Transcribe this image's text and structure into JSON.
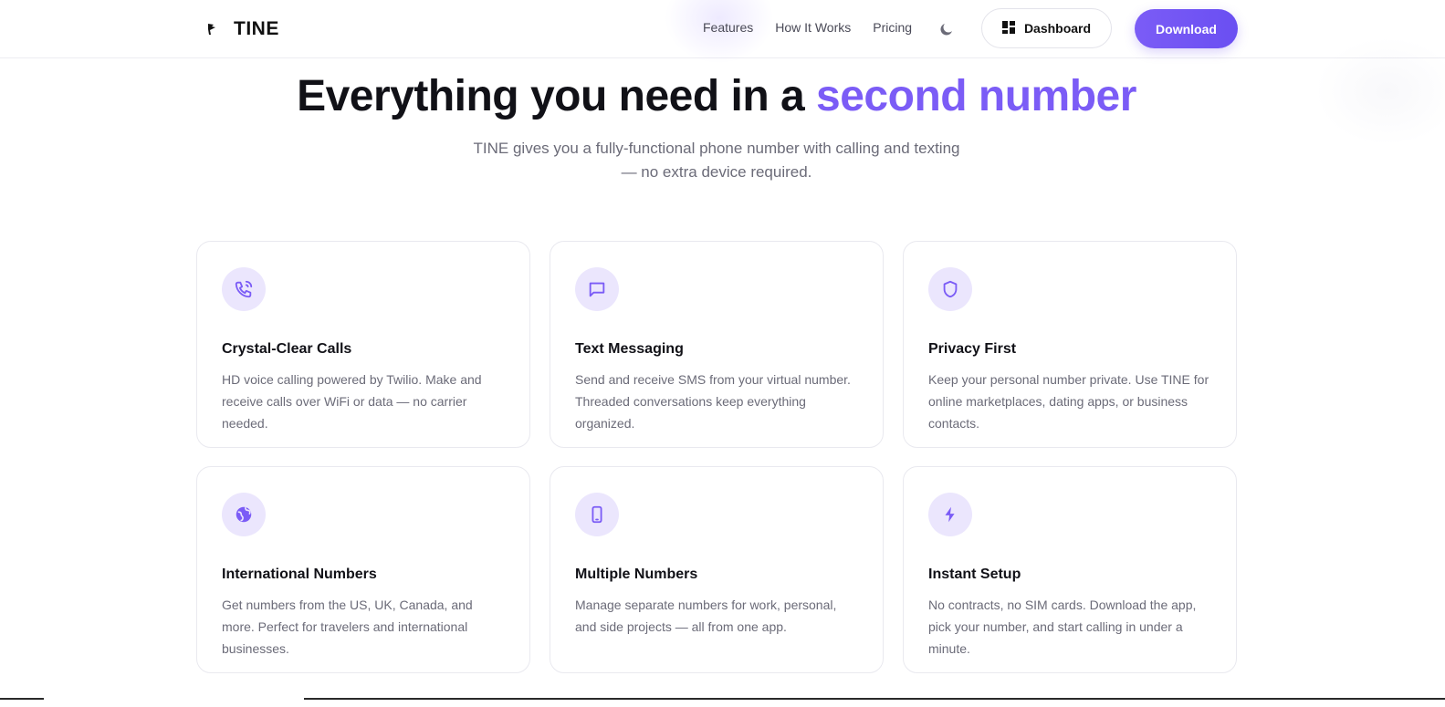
{
  "brand": {
    "name": "TINE",
    "logo_icon": "tine-logo-icon"
  },
  "nav": {
    "links": [
      "Features",
      "How It Works",
      "Pricing"
    ],
    "theme_toggle_icon": "moon-icon",
    "dashboard_label": "Dashboard",
    "dashboard_icon": "dashboard-grid-icon",
    "download_label": "Download"
  },
  "hero": {
    "title_main": "Everything you need in a ",
    "title_accent": "second number",
    "subtitle_line1": "TINE gives you a fully-functional phone number with calling and texting",
    "subtitle_line2": "— no extra device required."
  },
  "features": [
    {
      "icon": "phone-call-icon",
      "title": "Crystal-Clear Calls",
      "description": "HD voice calling powered by Twilio. Make and receive calls over WiFi or data — no carrier needed."
    },
    {
      "icon": "message-square-icon",
      "title": "Text Messaging",
      "description": "Send and receive SMS from your virtual number. Threaded conversations keep everything organized."
    },
    {
      "icon": "shield-icon",
      "title": "Privacy First",
      "description": "Keep your personal number private. Use TINE for online marketplaces, dating apps, or business contacts."
    },
    {
      "icon": "globe-icon",
      "title": "International Numbers",
      "description": "Get numbers from the US, UK, Canada, and more. Perfect for travelers and international businesses."
    },
    {
      "icon": "smartphone-icon",
      "title": "Multiple Numbers",
      "description": "Manage separate numbers for work, personal, and side projects — all from one app."
    },
    {
      "icon": "lightning-icon",
      "title": "Instant Setup",
      "description": "No contracts, no SIM cards. Download the app, pick your number, and start calling in under a minute."
    }
  ],
  "colors": {
    "accent": "#7b5cf6",
    "icon_bg": "#ebe6fd",
    "text_muted": "#6b6b78"
  }
}
